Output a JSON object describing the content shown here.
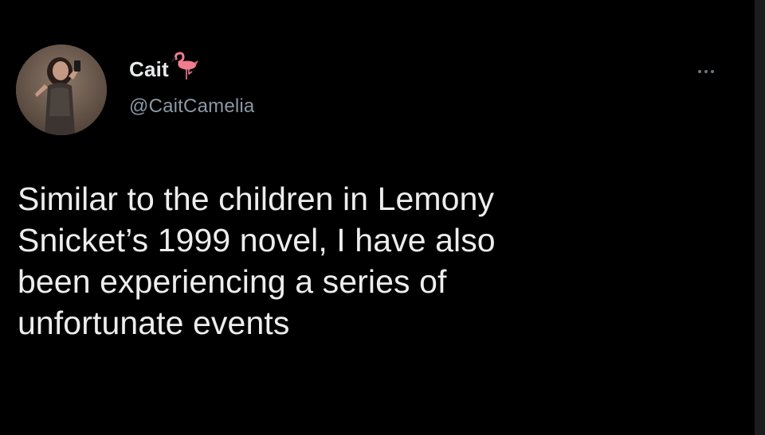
{
  "tweet": {
    "author": {
      "display_name": "Cait",
      "handle": "@CaitCamelia",
      "name_emoji": "flamingo-emoji"
    },
    "text": "Similar to the children in Lemony\nSnicket’s 1999 novel, I have also\nbeen experiencing a series of\nunfortunate events"
  },
  "icons": {
    "more": "more-options-icon",
    "avatar": "profile-photo"
  },
  "colors": {
    "background": "#000000",
    "name": "#e7e9ea",
    "handle": "#8b98a5",
    "text": "#ededed",
    "flamingo": "#f17c8f"
  }
}
